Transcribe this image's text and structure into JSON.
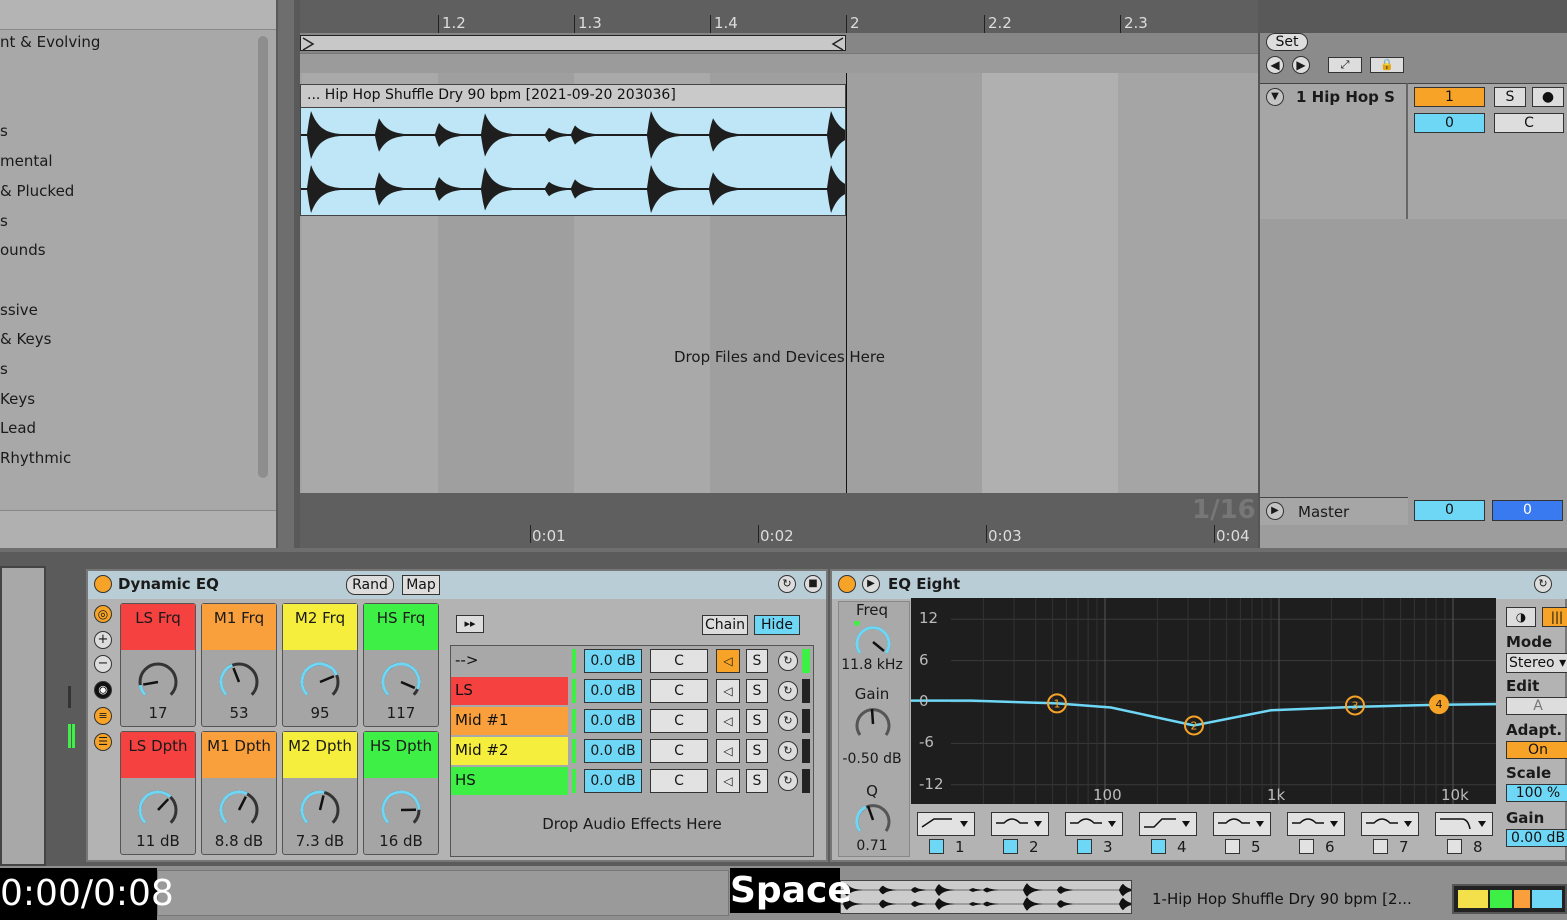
{
  "browser": {
    "categories": [
      "nt & Evolving",
      "s",
      "mental",
      "& Plucked",
      "s",
      "ounds",
      "ssive",
      "& Keys",
      "s",
      "Keys",
      "Lead",
      "Rhythmic"
    ]
  },
  "arrangement": {
    "ruler_labels": [
      "1.2",
      "1.3",
      "1.4",
      "2",
      "2.2",
      "2.3"
    ],
    "time_labels": [
      "0:01",
      "0:02",
      "0:03",
      "0:04"
    ],
    "clip_name": "... Hip Hop Shuffle Dry 90 bpm [2021-09-20 203036]",
    "drop_hint": "Drop Files and Devices Here",
    "quantize": "1/16"
  },
  "mixer": {
    "set_label": "Set",
    "track_name": "1 Hip Hop S",
    "track_number": "1",
    "track_volume": "0",
    "solo_label": "S",
    "pan_label": "C",
    "master_label": "Master",
    "master_volume": "0",
    "master_pan": "0"
  },
  "dynamic_eq": {
    "title": "Dynamic EQ",
    "rand_label": "Rand",
    "map_label": "Map",
    "chain_label": "Chain",
    "hide_label": "Hide",
    "drop_hint": "Drop Audio Effects Here",
    "macros": [
      {
        "label": "LS Frq",
        "value": "17",
        "color": "#f64141",
        "level": 0.13
      },
      {
        "label": "M1 Frq",
        "value": "53",
        "color": "#f9a03d",
        "level": 0.42
      },
      {
        "label": "M2 Frq",
        "value": "95",
        "color": "#f6ee3c",
        "level": 0.75
      },
      {
        "label": "HS Frq",
        "value": "117",
        "color": "#3ef046",
        "level": 0.92
      },
      {
        "label": "LS Dpth",
        "value": "11 dB",
        "color": "#f64141",
        "level": 0.66
      },
      {
        "label": "M1 Dpth",
        "value": "8.8 dB",
        "color": "#f9a03d",
        "level": 0.6
      },
      {
        "label": "M2 Dpth",
        "value": "7.3 dB",
        "color": "#f6ee3c",
        "level": 0.55
      },
      {
        "label": "HS Dpth",
        "value": "16 dB",
        "color": "#3ef046",
        "level": 0.83
      }
    ],
    "chains": [
      {
        "name": "-->",
        "color": "#a8a8a8",
        "gain": "0.0 dB",
        "pan": "C",
        "solo": "S"
      },
      {
        "name": "LS",
        "color": "#f64141",
        "gain": "0.0 dB",
        "pan": "C",
        "solo": "S"
      },
      {
        "name": "Mid #1",
        "color": "#f9a03d",
        "gain": "0.0 dB",
        "pan": "C",
        "solo": "S"
      },
      {
        "name": "Mid #2",
        "color": "#f6ee3c",
        "gain": "0.0 dB",
        "pan": "C",
        "solo": "S"
      },
      {
        "name": "HS",
        "color": "#3ef046",
        "gain": "0.0 dB",
        "pan": "C",
        "solo": "S"
      }
    ]
  },
  "eq_eight": {
    "title": "EQ Eight",
    "freq_label": "Freq",
    "freq_value": "11.8 kHz",
    "gain_label": "Gain",
    "gain_value": "-0.50 dB",
    "q_label": "Q",
    "q_value": "0.71",
    "db_labels": [
      "12",
      "6",
      "0",
      "-6",
      "-12"
    ],
    "freq_labels": [
      "100",
      "1k",
      "10k"
    ],
    "band_numbers": [
      "1",
      "2",
      "3",
      "4",
      "5",
      "6",
      "7",
      "8"
    ],
    "nodes": [
      "1",
      "2",
      "3",
      "4"
    ],
    "mode_label": "Mode",
    "mode_value": "Stereo",
    "edit_label": "Edit",
    "edit_value": "A",
    "adapt_label": "Adapt. Q",
    "adapt_value": "On",
    "scale_label": "Scale",
    "scale_value": "100 %",
    "gain2_label": "Gain",
    "gain2_value": "0.00 dB"
  },
  "footer": {
    "time_overlay": "0:00/0:08",
    "key_overlay": "Space",
    "status": "1-Hip Hop Shuffle Dry 90 bpm [2..."
  },
  "colors": {
    "accent_orange": "#f7a327",
    "accent_blue": "#6fd7f6",
    "clip_blue": "#bfe6f6"
  }
}
